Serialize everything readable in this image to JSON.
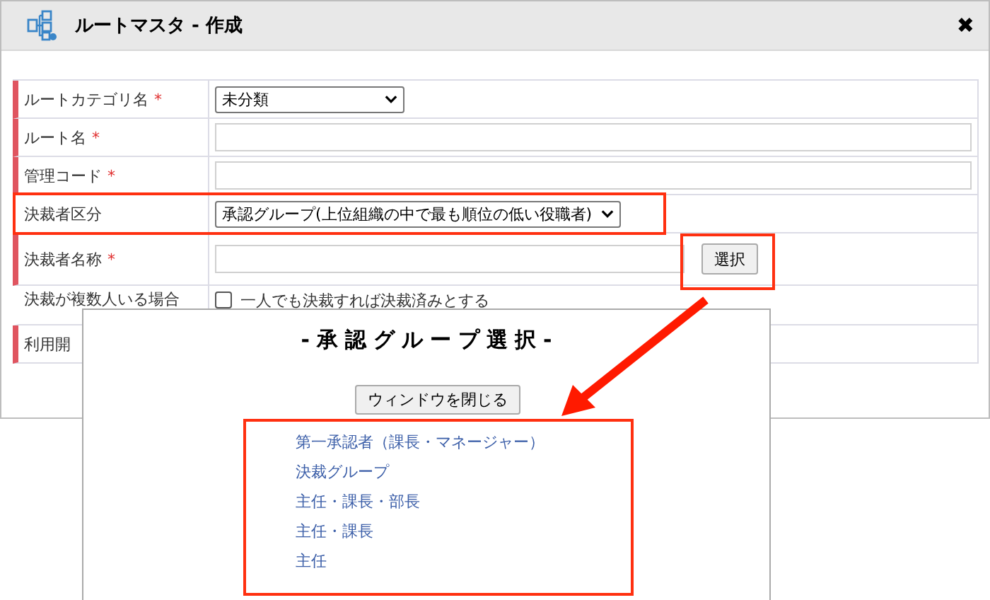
{
  "window": {
    "title": "ルートマスタ - 作成",
    "close": "✖"
  },
  "form": {
    "rows": [
      {
        "label": "ルートカテゴリ名",
        "mark": "*",
        "required": true,
        "kind": "select",
        "value": "未分類"
      },
      {
        "label": "ルート名",
        "mark": "*",
        "required": true,
        "kind": "input"
      },
      {
        "label": "管理コード",
        "mark": "*",
        "required": true,
        "kind": "input"
      },
      {
        "label": "決裁者区分",
        "required": false,
        "kind": "select",
        "value": "承認グループ(上位組織の中で最も順位の低い役職者)"
      },
      {
        "label": "決裁者名称",
        "mark": "*",
        "required": true,
        "kind": "input_button",
        "button": "選択"
      },
      {
        "label": "決裁が複数人いる場合",
        "required": false,
        "kind": "checkbox",
        "checked": false,
        "text": "一人でも決裁すれば決裁済みとする"
      },
      {
        "label": "利用開",
        "required": true,
        "kind": "covered"
      }
    ]
  },
  "popup": {
    "title": "-承認グループ選択-",
    "close_button": "ウィンドウを閉じる",
    "groups": [
      "第一承認者（課長・マネージャー）",
      "決裁グループ",
      "主任・課長・部長",
      "主任・課長",
      "主任"
    ]
  }
}
